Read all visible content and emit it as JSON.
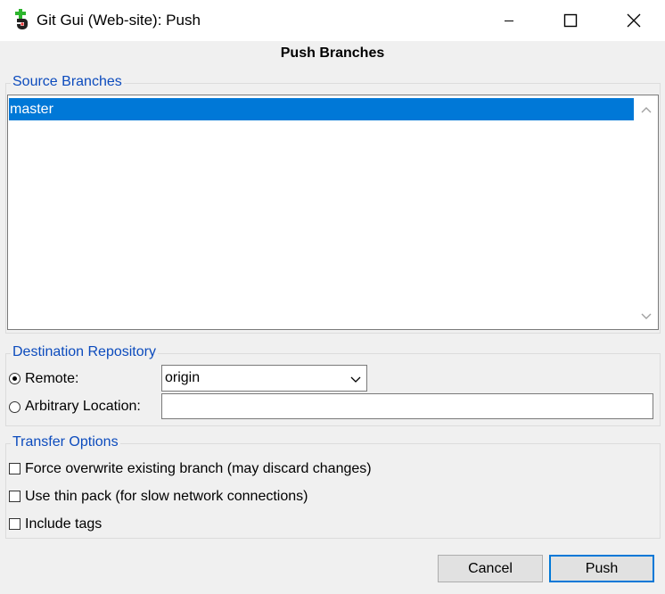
{
  "window": {
    "title": "Git Gui (Web-site): Push",
    "icon": "git-gui-icon"
  },
  "heading": "Push Branches",
  "source_branches": {
    "legend": "Source Branches",
    "items": [
      "master"
    ],
    "selected": "master"
  },
  "destination": {
    "legend": "Destination Repository",
    "remote_label": "Remote:",
    "remote_selected": true,
    "remote_value": "origin",
    "arbitrary_label": "Arbitrary Location:",
    "arbitrary_selected": false,
    "arbitrary_value": ""
  },
  "transfer_options": {
    "legend": "Transfer Options",
    "options": [
      {
        "label": "Force overwrite existing branch (may discard changes)",
        "checked": false
      },
      {
        "label": "Use thin pack (for slow network connections)",
        "checked": false
      },
      {
        "label": "Include tags",
        "checked": false
      }
    ]
  },
  "buttons": {
    "cancel": "Cancel",
    "push": "Push"
  },
  "colors": {
    "accent": "#0078d7",
    "legend": "#0c4bbd",
    "background": "#f0f0f0"
  }
}
